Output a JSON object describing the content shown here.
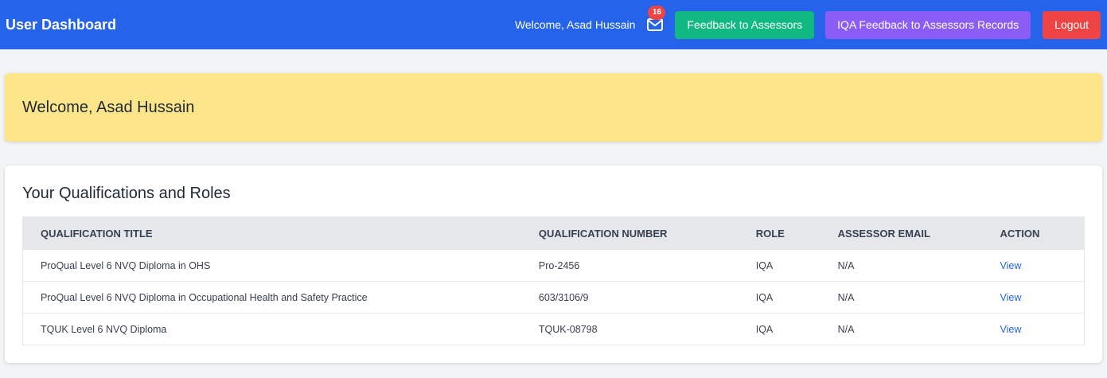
{
  "navbar": {
    "title": "User Dashboard",
    "welcome": "Welcome, Asad Hussain",
    "mail_badge": "16",
    "buttons": {
      "feedback": "Feedback to Assessors",
      "iqa_feedback": "IQA Feedback to Assessors Records",
      "logout": "Logout"
    }
  },
  "welcome_card": {
    "heading": "Welcome, Asad Hussain"
  },
  "qualifications": {
    "heading": "Your Qualifications and Roles",
    "columns": [
      "QUALIFICATION TITLE",
      "QUALIFICATION NUMBER",
      "ROLE",
      "ASSESSOR EMAIL",
      "ACTION"
    ],
    "rows": [
      [
        "ProQual Level 6 NVQ Diploma in OHS",
        "Pro-2456",
        "IQA",
        "N/A",
        "View"
      ],
      [
        "ProQual Level 6 NVQ Diploma in Occupational Health and Safety Practice",
        "603/3106/9",
        "IQA",
        "N/A",
        "View"
      ],
      [
        "TQUK Level 6 NVQ Diploma",
        "TQUK-08798",
        "IQA",
        "N/A",
        "View"
      ]
    ]
  },
  "colors": {
    "navbar": "#2563eb",
    "feedback_button": "#10b981",
    "iqa_button": "#8b5cf6",
    "logout_button": "#ef4444",
    "welcome_card": "#fde68a",
    "link": "#2563eb"
  },
  "icons": {
    "mail": "envelope-icon"
  }
}
